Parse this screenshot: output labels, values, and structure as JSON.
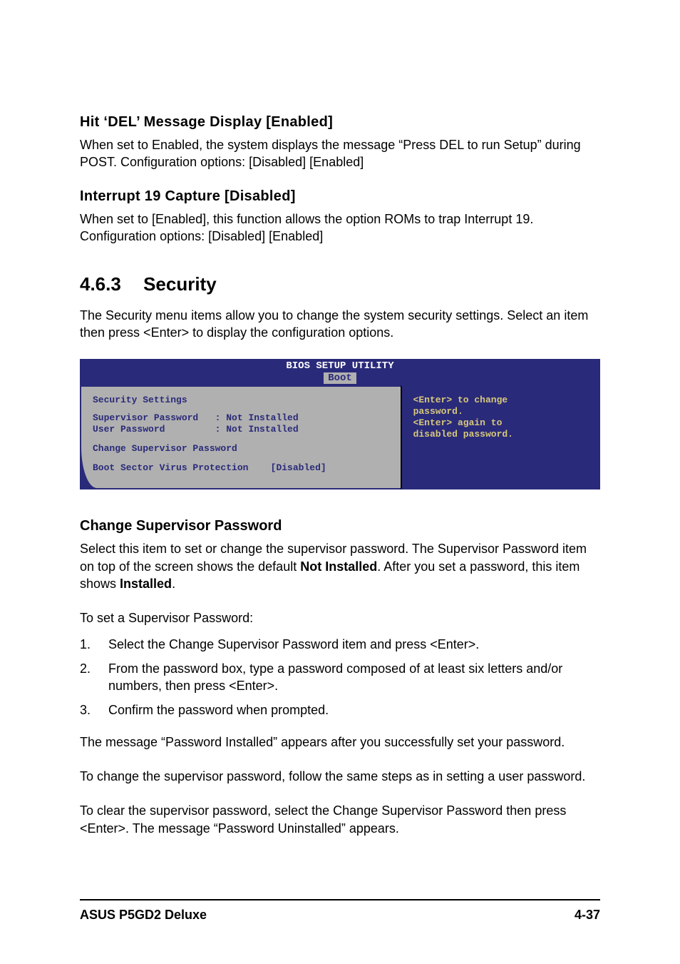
{
  "hit_del": {
    "heading": "Hit ‘DEL’ Message Display [Enabled]",
    "body": "When set to Enabled, the system displays the message “Press DEL to run Setup” during POST. Configuration options: [Disabled] [Enabled]"
  },
  "interrupt": {
    "heading": "Interrupt 19 Capture [Disabled]",
    "body": "When set to [Enabled], this function allows the option ROMs to trap Interrupt 19. Configuration options: [Disabled] [Enabled]"
  },
  "security": {
    "number": "4.6.3",
    "title": "Security",
    "intro": "The Security menu items allow you to change the system security settings. Select an item then press <Enter> to display the configuration options."
  },
  "bios": {
    "header_title": "BIOS SETUP UTILITY",
    "tab": "Boot",
    "left": {
      "title": "Security Settings",
      "row1_label": "Supervisor Password",
      "row1_value": ": Not Installed",
      "row2_label": "User Password",
      "row2_value": ": Not Installed",
      "row3": "Change Supervisor Password",
      "row4_label": "Boot Sector Virus Protection",
      "row4_value": "[Disabled]"
    },
    "right": {
      "line1": "<Enter> to change",
      "line2": "password.",
      "line3": "<Enter> again to",
      "line4": "disabled password."
    }
  },
  "change_pw": {
    "heading": "Change Supervisor Password",
    "p1a": "Select this item to set or change the supervisor password. The Supervisor Password item on top of the screen shows the default ",
    "p1b": "Not Installed",
    "p1c": ". After you set a password, this item shows ",
    "p1d": "Installed",
    "p1e": ".",
    "p2": "To set a Supervisor Password:",
    "steps": [
      "Select the Change Supervisor Password item and press <Enter>.",
      "From the password box, type a password composed of at least six letters and/or numbers, then press <Enter>.",
      "Confirm the password when prompted."
    ],
    "p3": "The message “Password Installed” appears after you successfully set your password.",
    "p4": "To change the supervisor password, follow the same steps as in setting a user password.",
    "p5": "To clear the supervisor password, select the Change Supervisor Password then press <Enter>. The message “Password Uninstalled” appears."
  },
  "footer": {
    "left": "ASUS P5GD2 Deluxe",
    "right": "4-37"
  },
  "nums": {
    "n1": "1.",
    "n2": "2.",
    "n3": "3."
  }
}
